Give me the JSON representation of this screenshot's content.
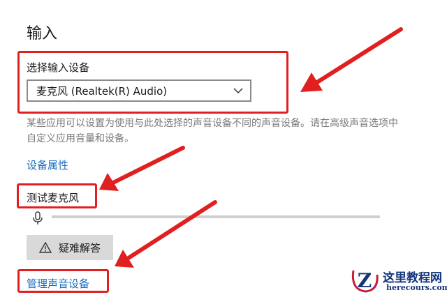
{
  "section_title": "输入",
  "select_device_label": "选择输入设备",
  "selected_device": "麦克风 (Realtek(R) Audio)",
  "description": "某些应用可以设置为使用与此处选择的声音设备不同的声音设备。请在高级声音选项中自定义应用音量和设备。",
  "device_properties_link": "设备属性",
  "test_mic_label": "测试麦克风",
  "mic_level": 0,
  "troubleshoot_label": "疑难解答",
  "manage_devices_link": "管理声音设备",
  "icons": {
    "dropdown": "chevron-down-icon",
    "mic": "microphone-icon",
    "troubleshoot": "warning-icon"
  },
  "colors": {
    "annotation": "#e02020",
    "link": "#1a6fc0"
  },
  "watermark": {
    "title": "这里教程网",
    "url": "herecours.com"
  }
}
